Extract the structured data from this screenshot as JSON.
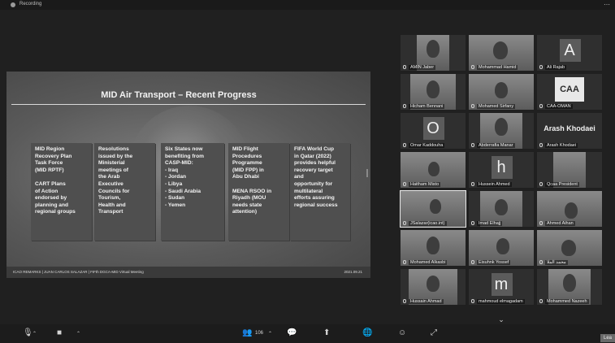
{
  "window": {
    "recording_label": "Recording"
  },
  "slide": {
    "title": "MID Air Transport – Recent Progress",
    "cards": [
      "MID Region\nRecovery Plan\nTask Force\n(MID RPTF)\n\nCART Plans\nof Action\nendorsed by\nplanning and\nregional groups",
      "Resolutions\nissued by the\nMinisterial\nmeetings of\nthe Arab\nExecutive\nCouncils for\nTourism,\nHealth and\nTransport",
      "Six States now\nbenefiting from\nCASP-MID:\n- Iraq\n- Jordan\n- Libya\n- Saudi Arabia\n- Sudan\n- Yemen",
      "MID Flight\nProcedures\nProgramme\n(MID FPP) in\nAbu Dhabi\n\nMENA RSOO in\nRiyadh (MOU\nneeds state\nattention)",
      "FIFA World Cup\nin Qatar (2022)\nprovides helpful\nrecovery target\nand\nopportunity for\nmultilateral\nefforts assuring\nregional success"
    ],
    "footer_left": "ICAO REMARKS | JUAN CARLOS SALAZAR | FIFth DGCA-MID Virtual Meeting",
    "footer_right": "2021.09.21"
  },
  "participants": [
    {
      "name": "AMIN Jaber",
      "kind": "video"
    },
    {
      "name": "Mohammad Hamid",
      "kind": "video"
    },
    {
      "name": "Ali Rajab",
      "kind": "letter",
      "letter": "A"
    },
    {
      "name": "Hicham Bennani",
      "kind": "video"
    },
    {
      "name": "Mohamed Sirfany",
      "kind": "video"
    },
    {
      "name": "CAA-OMAN",
      "kind": "logo",
      "logo_text": "CAA"
    },
    {
      "name": "Omar Kaddouha",
      "kind": "letter",
      "letter": "O"
    },
    {
      "name": "Abderrafia Manar",
      "kind": "video"
    },
    {
      "name": "Arash Khodaei",
      "kind": "bigname",
      "big": "Arash Khodaei"
    },
    {
      "name": "Haitham Misto",
      "kind": "video"
    },
    {
      "name": "Hussein Ahmed",
      "kind": "letter",
      "letter": "h"
    },
    {
      "name": "Qcaa President",
      "kind": "video"
    },
    {
      "name": "JSalazar(icao.int)",
      "kind": "video"
    },
    {
      "name": "Imad Elhajj",
      "kind": "video"
    },
    {
      "name": "Ahmed Aihan",
      "kind": "video"
    },
    {
      "name": "Mohamed Alkasbi",
      "kind": "video"
    },
    {
      "name": "Eisuhnk Yossef",
      "kind": "video"
    },
    {
      "name": "محمد الملا",
      "kind": "video"
    },
    {
      "name": "Hussain Ahmad",
      "kind": "video"
    },
    {
      "name": "mahmoud elmagadam",
      "kind": "letter",
      "letter": "m"
    },
    {
      "name": "Mohammed Nazeeh",
      "kind": "video"
    }
  ],
  "toolbar": {
    "participants_count": "106",
    "leave_label": "Lea"
  }
}
